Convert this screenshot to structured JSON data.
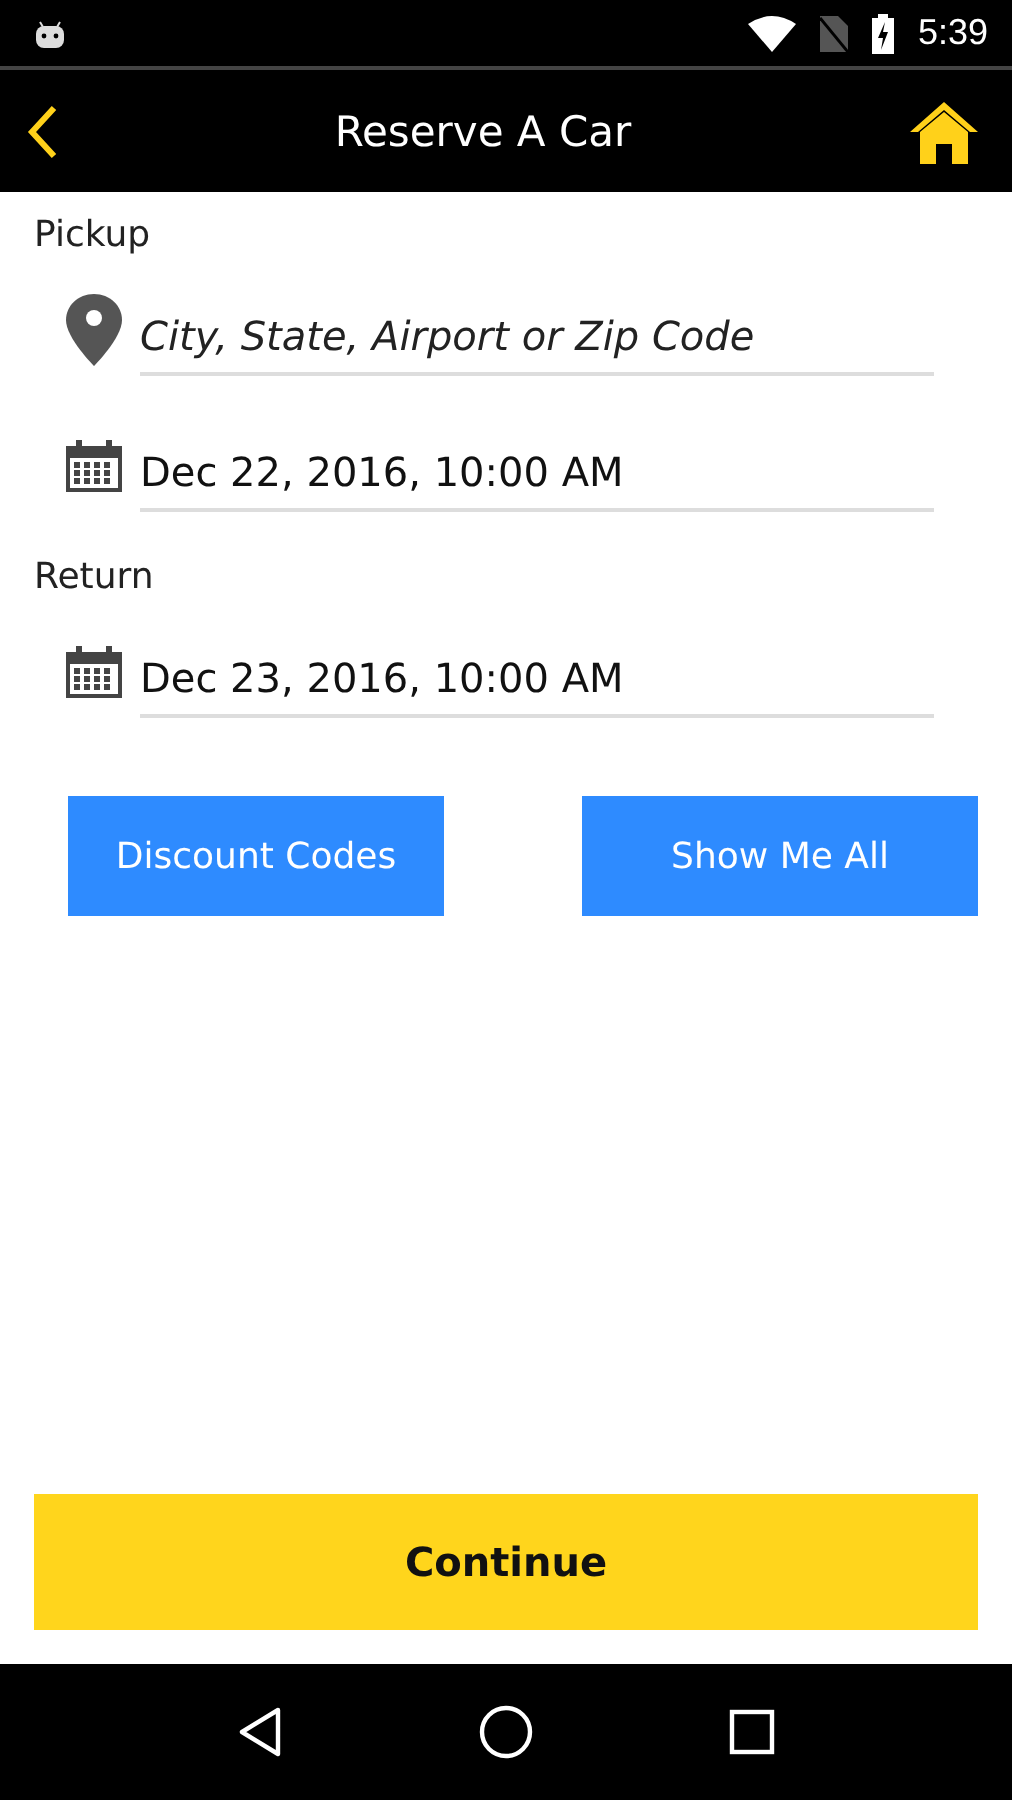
{
  "status_bar": {
    "time": "5:39"
  },
  "header": {
    "title": "Reserve A Car"
  },
  "sections": [
    {
      "label": "Pickup",
      "fields": [
        {
          "kind": "location",
          "placeholder": "City, State, Airport or Zip Code"
        },
        {
          "kind": "date",
          "value": "Dec 22, 2016, 10:00 AM"
        }
      ]
    },
    {
      "label": "Return",
      "fields": [
        {
          "kind": "date",
          "value": "Dec 23, 2016, 10:00 AM"
        }
      ]
    }
  ],
  "buttons": [
    "Discount Codes",
    "Show Me All"
  ],
  "continue_button": "Continue"
}
